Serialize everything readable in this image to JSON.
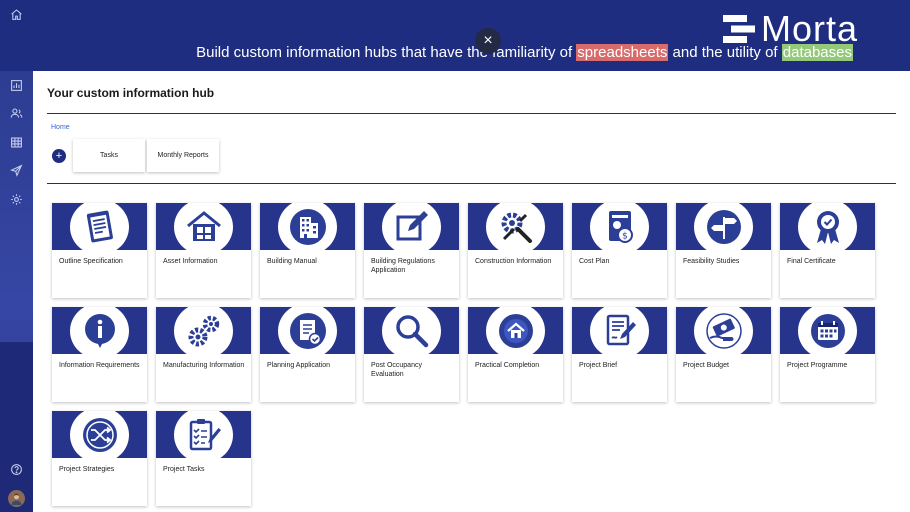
{
  "header": {
    "logo_text": "Morta",
    "tagline_before": "Build custom information hubs that have the familiarity of ",
    "tagline_hl1": "spreadsheets",
    "tagline_mid": " and the utility of ",
    "tagline_hl2": "databases",
    "close_symbol": "×"
  },
  "sidebar": {
    "items": [
      {
        "icon": "home-icon"
      },
      {
        "icon": "dashboard-icon"
      },
      {
        "icon": "users-icon"
      },
      {
        "icon": "table-icon"
      },
      {
        "icon": "send-icon"
      },
      {
        "icon": "settings-icon"
      }
    ],
    "help_icon": "help-icon",
    "avatar": "user-avatar"
  },
  "main": {
    "title": "Your custom information hub",
    "breadcrumb": "Home",
    "add_symbol": "+",
    "tabs": [
      {
        "label": "Tasks"
      },
      {
        "label": "Monthly Reports"
      }
    ],
    "cards": [
      {
        "label": "Outline Specification",
        "icon": "document-list-icon"
      },
      {
        "label": "Asset Information",
        "icon": "house-puzzle-icon"
      },
      {
        "label": "Building Manual",
        "icon": "building-icon"
      },
      {
        "label": "Building Regulations Application",
        "icon": "edit-icon"
      },
      {
        "label": "Construction Information",
        "icon": "tools-icon"
      },
      {
        "label": "Cost Plan",
        "icon": "cost-report-icon"
      },
      {
        "label": "Feasibility Studies",
        "icon": "signpost-icon"
      },
      {
        "label": "Final Certificate",
        "icon": "award-icon"
      },
      {
        "label": "Information Requirements",
        "icon": "info-icon"
      },
      {
        "label": "Manufacturing Information",
        "icon": "gears-icon"
      },
      {
        "label": "Planning Application",
        "icon": "approved-document-icon"
      },
      {
        "label": "Post Occupancy Evaluation",
        "icon": "magnifier-icon"
      },
      {
        "label": "Practical Completion",
        "icon": "home-badge-icon"
      },
      {
        "label": "Project Brief",
        "icon": "brief-document-icon"
      },
      {
        "label": "Project Budget",
        "icon": "money-hand-icon"
      },
      {
        "label": "Project Programme",
        "icon": "calendar-icon"
      },
      {
        "label": "Project Strategies",
        "icon": "shuffle-icon"
      },
      {
        "label": "Project Tasks",
        "icon": "checklist-icon"
      }
    ]
  },
  "colors": {
    "navy": "#1f2d80",
    "band": "#27348c",
    "highlight_red": "#d86b6b",
    "highlight_green": "#94c97a",
    "link": "#3c63c6"
  }
}
